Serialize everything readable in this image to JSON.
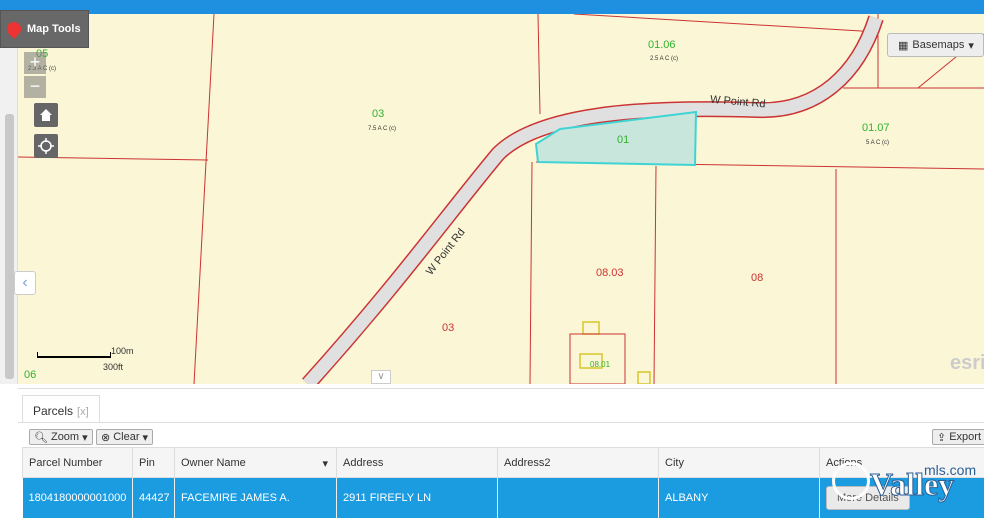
{
  "map_tools": {
    "label": "Map Tools"
  },
  "zoom": {
    "in": "+",
    "out": "−"
  },
  "basemaps": {
    "label": "Basemaps"
  },
  "map": {
    "road_label_1": "W Point Rd",
    "road_label_2": "W Point Rd",
    "parcel_labels": [
      {
        "text": "03",
        "color": "green"
      },
      {
        "text": "01.06",
        "color": "green"
      },
      {
        "text": "01",
        "color": "green"
      },
      {
        "text": "01.07",
        "color": "green"
      },
      {
        "text": "08.03",
        "color": "red"
      },
      {
        "text": "08",
        "color": "red"
      },
      {
        "text": "03",
        "color": "red"
      },
      {
        "text": "06",
        "color": "green"
      },
      {
        "text": "05",
        "color": "green"
      },
      {
        "text": "08.01",
        "color": "green"
      }
    ],
    "acreage_labels": [
      "7.5 A C (c)",
      "2.5 A C (c)",
      "5 A C (c)",
      "2.3 A C (c)"
    ],
    "scale": {
      "metric": "100m",
      "imperial": "300ft"
    },
    "attribution": "esri",
    "highlight_color": "#3fd4d4"
  },
  "panel": {
    "tab_label": "Parcels",
    "tab_close": "[x]",
    "toolbar": {
      "zoom_label": "Zoom",
      "clear_label": "Clear",
      "export_label": "Export"
    },
    "columns": [
      "Parcel Number",
      "Pin",
      "Owner Name",
      "Address",
      "Address2",
      "City",
      "Actions"
    ],
    "rows": [
      {
        "parcel_number": "1804180000001000",
        "pin": "44427",
        "owner_name": "FACEMIRE JAMES A.",
        "address": "2911 FIREFLY LN",
        "address2": "",
        "city": "ALBANY",
        "action_label": "More Details"
      }
    ]
  },
  "watermark": {
    "brand": "Valley",
    "suffix": "mls.com"
  }
}
